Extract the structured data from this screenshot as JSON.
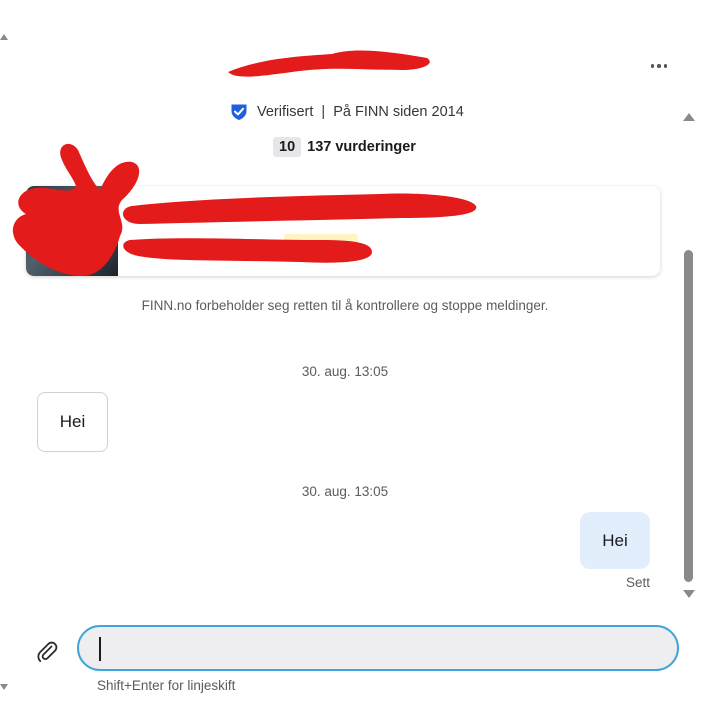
{
  "header": {
    "verified_label": "Verifisert",
    "separator": "|",
    "member_since": "På FINN siden 2014",
    "rating_score": "10",
    "rating_count": "137 vurderinger",
    "more_icon": "more-horizontal-icon"
  },
  "notice": "FINN.no forbeholder seg retten til å kontrollere og stoppe meldinger.",
  "messages": [
    {
      "timestamp": "30. aug. 13:05",
      "text": "Hei",
      "direction": "incoming"
    },
    {
      "timestamp": "30. aug. 13:05",
      "text": "Hei",
      "direction": "outgoing",
      "status": "Sett"
    }
  ],
  "composer": {
    "value": "",
    "placeholder": "",
    "hint": "Shift+Enter for linjeskift",
    "attach_icon": "paperclip-icon"
  },
  "colors": {
    "verified_blue": "#1f5fe0",
    "outgoing_bubble": "#e3eefd",
    "input_border": "#3da5d9",
    "redaction": "#e41b1b"
  }
}
